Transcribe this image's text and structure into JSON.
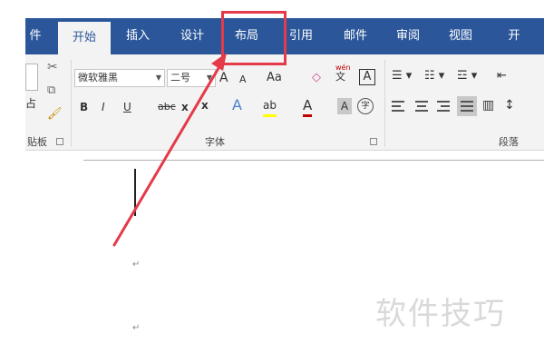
{
  "ribbon": {
    "tabs": [
      {
        "label": "件",
        "active": false
      },
      {
        "label": "开始",
        "active": true
      },
      {
        "label": "插入",
        "active": false
      },
      {
        "label": "设计",
        "active": false
      },
      {
        "label": "布局",
        "active": false
      },
      {
        "label": "引用",
        "active": false
      },
      {
        "label": "邮件",
        "active": false
      },
      {
        "label": "审阅",
        "active": false
      },
      {
        "label": "视图",
        "active": false
      },
      {
        "label": "开",
        "active": false
      }
    ],
    "groups": {
      "clipboard_label": "贴板",
      "font_label": "字体",
      "paragraph_label": "段落"
    },
    "clipboard": {
      "paste_label": "占"
    },
    "font": {
      "font_name": "微软雅黑",
      "font_size": "二号",
      "grow": "A",
      "shrink": "A",
      "case": "Aa",
      "phonetic_top": "wén",
      "phonetic_bottom": "文",
      "border_char": "A",
      "bold": "B",
      "italic": "I",
      "underline": "U",
      "strike": "abc",
      "subscript": "x",
      "superscript": "x",
      "effects": "A",
      "highlight": "ab",
      "color": "A",
      "shading": "A",
      "enclose": "字"
    }
  },
  "document": {
    "paragraph_mark": "↵"
  },
  "watermark": "软件技巧",
  "colors": {
    "ribbon_blue": "#2b579a",
    "annotation_red": "#e43a4a",
    "highlight_yellow": "#ffff00",
    "font_color_red": "#c00000"
  }
}
